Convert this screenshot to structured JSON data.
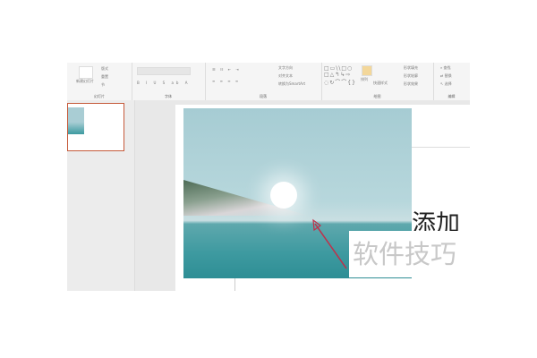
{
  "ribbon": {
    "slides": {
      "new_slide": "新建幻灯片",
      "layout": "版式",
      "reset": "重置",
      "section": "节",
      "label": "幻灯片"
    },
    "font": {
      "label": "字体"
    },
    "paragraph": {
      "text_direction": "文字方向",
      "align_text": "对齐文本",
      "smartart": "转换为SmartArt",
      "label": "段落"
    },
    "drawing": {
      "arrange": "排列",
      "quick_styles": "快速样式",
      "shape_fill": "形状填充",
      "shape_outline": "形状轮廓",
      "shape_effects": "形状效果",
      "label": "绘图"
    },
    "editing": {
      "find": "查找",
      "replace": "替换",
      "select": "选择",
      "label": "编辑"
    }
  },
  "slide": {
    "title_text": "添加",
    "watermark": "软件技巧"
  },
  "colors": {
    "selected_border": "#c55a3a",
    "arrow": "#c0304a"
  }
}
